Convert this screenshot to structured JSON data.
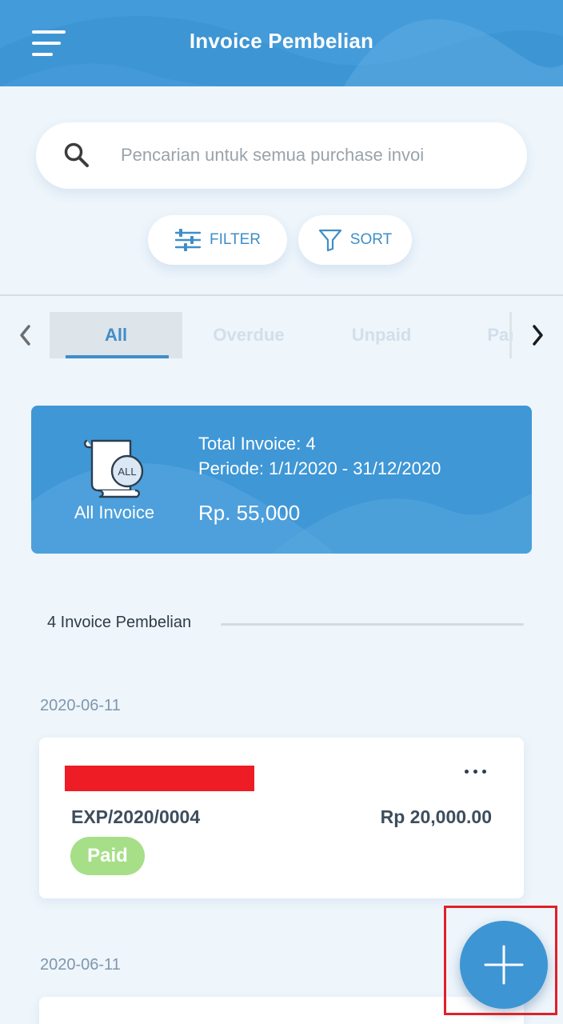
{
  "header": {
    "title": "Invoice Pembelian",
    "menu_icon": "hamburger-menu-icon",
    "background_color": "#3d95d4"
  },
  "search": {
    "placeholder": "Pencarian untuk semua purchase invoi",
    "value": "",
    "icon": "search-icon"
  },
  "actions": {
    "filter_label": "FILTER",
    "filter_icon": "sliders-icon",
    "sort_label": "SORT",
    "sort_icon": "funnel-icon"
  },
  "tabs": [
    {
      "label": "All",
      "active": true
    },
    {
      "label": "Overdue",
      "active": false
    },
    {
      "label": "Unpaid",
      "active": false
    },
    {
      "label": "Partial",
      "active": false
    }
  ],
  "summary": {
    "icon_badge": "ALL",
    "caption": "All Invoice",
    "total_line": "Total Invoice: 4",
    "period_line": "Periode: 1/1/2020 - 31/12/2020",
    "amount": "Rp. 55,000"
  },
  "list": {
    "title": "4 Invoice Pembelian",
    "groups": [
      {
        "date": "2020-06-11",
        "invoices": [
          {
            "number": "EXP/2020/0004",
            "amount": "Rp 20,000.00",
            "status": "Paid",
            "status_color": "#a6df88"
          }
        ]
      },
      {
        "date": "2020-06-11",
        "invoices": []
      }
    ]
  },
  "colors": {
    "accent": "#3d95d4",
    "page_background": "#eef5fb",
    "redaction": "#ee1c25",
    "highlight_box": "#e0202a"
  },
  "fab": {
    "icon": "plus-icon"
  }
}
